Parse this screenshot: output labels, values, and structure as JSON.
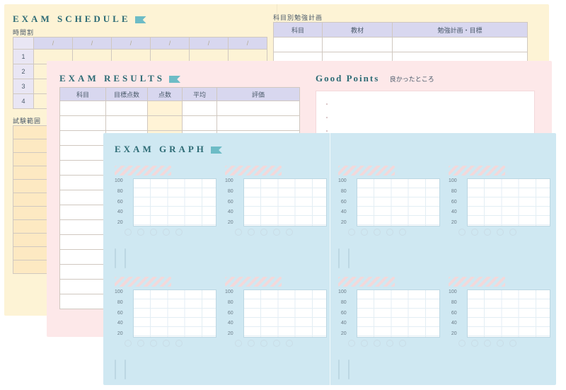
{
  "schedule": {
    "title": "EXAM SCHEDULE",
    "timetable_label": "時間割",
    "date_placeholder": "/",
    "period_numbers": [
      "1",
      "2",
      "3",
      "4"
    ],
    "range_label": "試験範囲",
    "plan_heading": "科目別勉強計画",
    "plan_columns": {
      "subject": "科目",
      "material": "教材",
      "plan": "勉強計画・目標"
    }
  },
  "results": {
    "title": "EXAM RESULTS",
    "columns": {
      "subject": "科目",
      "target": "目標点数",
      "score": "点数",
      "avg": "平均",
      "eval": "評価"
    },
    "good_title": "Good Points",
    "good_sub": "良かったところ",
    "bullets": [
      "・",
      "・",
      "・"
    ]
  },
  "graph": {
    "title": "EXAM GRAPH"
  },
  "chart_data": [
    {
      "type": "bar",
      "title": "",
      "categories": [
        "",
        "",
        "",
        "",
        ""
      ],
      "values": [],
      "ylim": [
        0,
        100
      ],
      "yticks": [
        100,
        80,
        60,
        40,
        20
      ]
    },
    {
      "type": "bar",
      "title": "",
      "categories": [
        "",
        "",
        "",
        "",
        ""
      ],
      "values": [],
      "ylim": [
        0,
        100
      ],
      "yticks": [
        100,
        80,
        60,
        40,
        20
      ]
    },
    {
      "type": "bar",
      "title": "",
      "categories": [
        "",
        "",
        "",
        "",
        ""
      ],
      "values": [],
      "ylim": [
        0,
        100
      ],
      "yticks": [
        100,
        80,
        60,
        40,
        20
      ]
    },
    {
      "type": "bar",
      "title": "",
      "categories": [
        "",
        "",
        "",
        "",
        ""
      ],
      "values": [],
      "ylim": [
        0,
        100
      ],
      "yticks": [
        100,
        80,
        60,
        40,
        20
      ]
    },
    {
      "type": "bar",
      "title": "",
      "categories": [
        "",
        "",
        "",
        "",
        ""
      ],
      "values": [],
      "ylim": [
        0,
        100
      ],
      "yticks": [
        100,
        80,
        60,
        40,
        20
      ]
    },
    {
      "type": "bar",
      "title": "",
      "categories": [
        "",
        "",
        "",
        "",
        ""
      ],
      "values": [],
      "ylim": [
        0,
        100
      ],
      "yticks": [
        100,
        80,
        60,
        40,
        20
      ]
    },
    {
      "type": "bar",
      "title": "",
      "categories": [
        "",
        "",
        "",
        "",
        ""
      ],
      "values": [],
      "ylim": [
        0,
        100
      ],
      "yticks": [
        100,
        80,
        60,
        40,
        20
      ]
    },
    {
      "type": "bar",
      "title": "",
      "categories": [
        "",
        "",
        "",
        "",
        ""
      ],
      "values": [],
      "ylim": [
        0,
        100
      ],
      "yticks": [
        100,
        80,
        60,
        40,
        20
      ]
    }
  ]
}
